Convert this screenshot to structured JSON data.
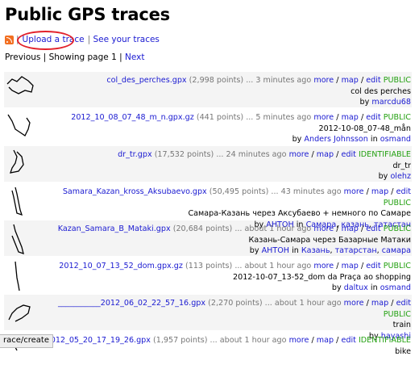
{
  "page": {
    "title": "Public GPS traces"
  },
  "toolbar": {
    "upload": "Upload a trace",
    "separator": "|",
    "see_yours": "See your traces"
  },
  "pager": {
    "previous": "Previous",
    "showing": "Showing page 1",
    "next": "Next",
    "sep": "|"
  },
  "labels": {
    "more": "more",
    "map": "map",
    "edit": "edit",
    "by": "by",
    "in": "in",
    "slash": "/"
  },
  "traces": [
    {
      "file": "col_des_perches.gpx",
      "points": "(2,998 points)",
      "time": "3 minutes ago",
      "vis": "PUBLIC",
      "desc": "col des perches",
      "user": "marcdu68",
      "tags": []
    },
    {
      "file": "2012_10_08_07_48_m_n.gpx.gz",
      "points": "(441 points)",
      "time": "5 minutes ago",
      "vis": "PUBLIC",
      "desc": "2012-10-08_07-48_mån",
      "user": "Anders Johnsson",
      "tags": [
        "osmand"
      ]
    },
    {
      "file": "dr_tr.gpx",
      "points": "(17,532 points)",
      "time": "24 minutes ago",
      "vis": "IDENTIFIABLE",
      "desc": "dr_tr",
      "user": "olehz",
      "tags": []
    },
    {
      "file": "Samara_Kazan_kross_Aksubaevo.gpx",
      "points": "(50,495 points)",
      "time": "43 minutes ago",
      "vis": "PUBLIC",
      "desc": "Самара-Казань через Аксубаево + немного по Самаре",
      "user": "АНТОН",
      "tags": [
        "Самара",
        "казань",
        "татастан"
      ]
    },
    {
      "file": "Kazan_Samara_B_Mataki.gpx",
      "points": "(20,684 points)",
      "time": "about 1 hour ago",
      "vis": "PUBLIC",
      "desc": "Казань-Самара через Базарные Матаки",
      "user": "АНТОН",
      "tags": [
        "Казань",
        "татарстан",
        "самара"
      ]
    },
    {
      "file": "2012_10_07_13_52_dom.gpx.gz",
      "points": "(113 points)",
      "time": "about 1 hour ago",
      "vis": "PUBLIC",
      "desc": "2012-10-07_13-52_dom da Praça ao shopping",
      "user": "daltux",
      "tags": [
        "osmand"
      ]
    },
    {
      "file": "___________2012_06_02_22_57_16.gpx",
      "points": "(2,270 points)",
      "time": "about 1 hour ago",
      "vis": "PUBLIC",
      "desc": "train",
      "user": "hayashi",
      "tags": []
    },
    {
      "file": "2012_05_20_17_19_26.gpx",
      "points": "(1,957 points)",
      "time": "about 1 hour ago",
      "vis": "IDENTIFIABLE",
      "desc": "bike",
      "user": "",
      "tags": []
    }
  ],
  "status_tooltip": "race/create"
}
